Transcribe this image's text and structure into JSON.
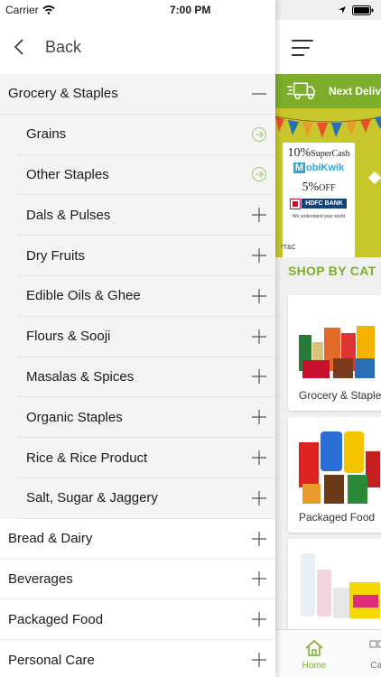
{
  "status_bar": {
    "carrier": "Carrier",
    "time": "7:00 PM"
  },
  "drawer": {
    "back_label": "Back",
    "expanded_category": {
      "label": "Grocery & Staples",
      "subcategories": [
        {
          "label": "Grains",
          "icon": "arrow-circle-icon"
        },
        {
          "label": "Other Staples",
          "icon": "arrow-circle-icon"
        },
        {
          "label": "Dals & Pulses",
          "icon": "plus-icon"
        },
        {
          "label": "Dry Fruits",
          "icon": "plus-icon"
        },
        {
          "label": "Edible Oils & Ghee",
          "icon": "plus-icon"
        },
        {
          "label": "Flours & Sooji",
          "icon": "plus-icon"
        },
        {
          "label": "Masalas & Spices",
          "icon": "plus-icon"
        },
        {
          "label": "Organic Staples",
          "icon": "plus-icon"
        },
        {
          "label": "Rice & Rice Product",
          "icon": "plus-icon"
        },
        {
          "label": "Salt, Sugar & Jaggery",
          "icon": "plus-icon"
        }
      ]
    },
    "categories": [
      {
        "label": "Bread & Dairy"
      },
      {
        "label": "Beverages"
      },
      {
        "label": "Packaged Food"
      },
      {
        "label": "Personal Care"
      }
    ]
  },
  "app": {
    "delivery_text": "Next Deliv",
    "banner": {
      "supercash_pct": "10%",
      "supercash_label": "SuperCash",
      "mobikwik_m": "M",
      "mobikwik_rest": "obiKwik",
      "off_pct": "5%",
      "off_label": "OFF",
      "bank": "HDFC BANK",
      "bank_tagline": "We understand your world",
      "tc": "*T&C"
    },
    "shop_title": "SHOP BY CAT",
    "category_cards": [
      {
        "label": "Grocery & Staple"
      },
      {
        "label": "Packaged Food"
      },
      {
        "label": ""
      }
    ],
    "tabs": [
      {
        "label": "Home",
        "active": true
      },
      {
        "label": "Cat",
        "active": false
      }
    ]
  },
  "colors": {
    "brand_green": "#7cae2c",
    "banner_yellow": "#c7c62b"
  }
}
